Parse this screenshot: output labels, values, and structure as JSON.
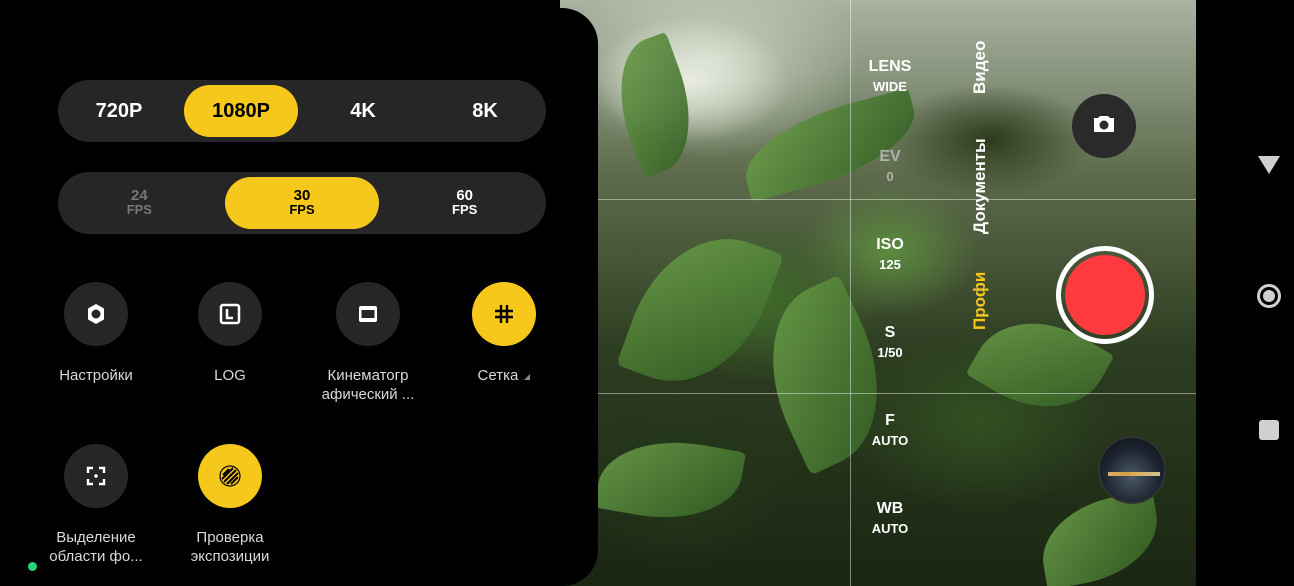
{
  "resolution": {
    "options": [
      "720P",
      "1080P",
      "4K",
      "8K"
    ],
    "selected": "1080P"
  },
  "fps": {
    "options": [
      {
        "value": "24",
        "unit": "FPS"
      },
      {
        "value": "30",
        "unit": "FPS"
      },
      {
        "value": "60",
        "unit": "FPS"
      }
    ],
    "selected": "30"
  },
  "tools": [
    {
      "label": "Настройки",
      "icon": "settings-gear-icon",
      "active": false
    },
    {
      "label": "LOG",
      "icon": "log-icon",
      "active": false
    },
    {
      "label": "Кинематогр\nафический ...",
      "icon": "cinematic-icon",
      "active": false
    },
    {
      "label": "Сетка",
      "icon": "grid-icon",
      "active": true
    },
    {
      "label": "Выделение\nобласти фо...",
      "icon": "focus-area-icon",
      "active": false
    },
    {
      "label": "Проверка\nэкспозиции",
      "icon": "exposure-check-icon",
      "active": true
    }
  ],
  "pro_controls": [
    {
      "name": "LENS",
      "value": "WIDE"
    },
    {
      "name": "EV",
      "value": "0"
    },
    {
      "name": "ISO",
      "value": "125"
    },
    {
      "name": "S",
      "value": "1/50"
    },
    {
      "name": "F",
      "value": "AUTO"
    },
    {
      "name": "WB",
      "value": "AUTO"
    }
  ],
  "modes": {
    "video": "Видео",
    "documents": "Документы",
    "pro": "Профи",
    "active": "pro"
  },
  "colors": {
    "accent": "#f7c81c",
    "record": "#ff3b3f",
    "panel": "#000000",
    "chip": "#262626"
  }
}
